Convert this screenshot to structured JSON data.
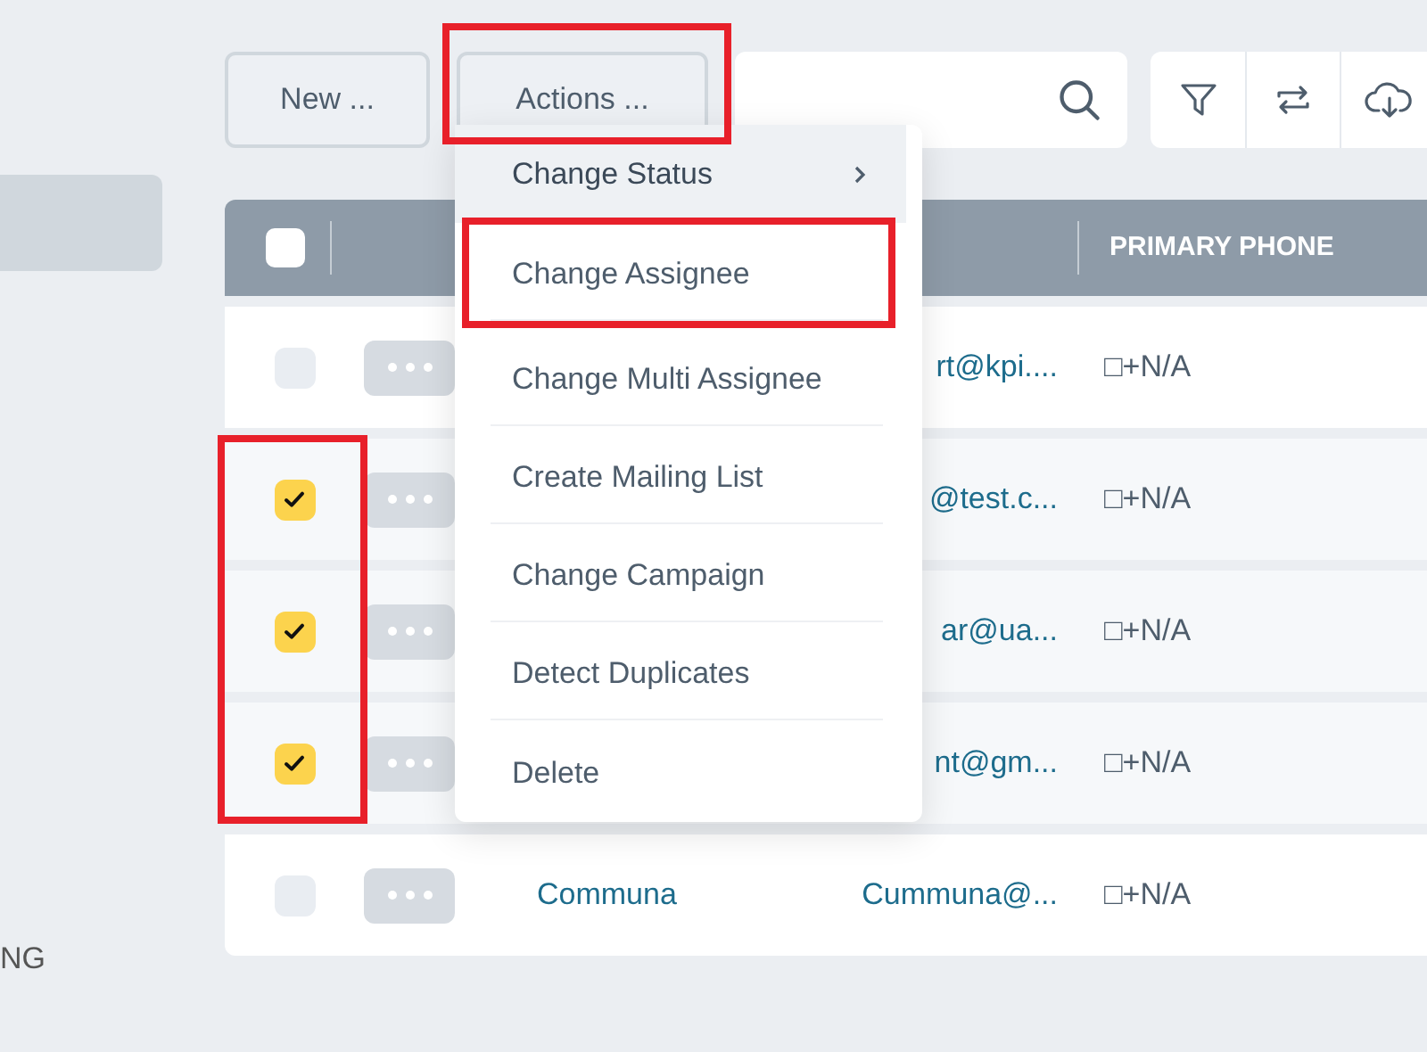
{
  "sidebar": {
    "items": [
      {
        "selected": true
      },
      {
        "label": "NG",
        "selected": false
      }
    ]
  },
  "toolbar": {
    "buttons": [
      "New ...",
      "Actions ..."
    ]
  },
  "table": {
    "header_checked": false,
    "columns": [
      "PRIMARY PHONE"
    ],
    "rows": [
      {
        "checked": false,
        "email": "rt@kpi....",
        "phone": "□+N/A"
      },
      {
        "checked": true,
        "email": "@test.c...",
        "phone": "□+N/A"
      },
      {
        "checked": true,
        "email": "ar@ua...",
        "phone": "□+N/A"
      },
      {
        "checked": true,
        "email": "nt@gm...",
        "phone": "□+N/A"
      },
      {
        "checked": false,
        "name": "Communa",
        "email": "Cummuna@...",
        "phone": "□+N/A"
      }
    ]
  },
  "menu": {
    "items": [
      {
        "label": "Change Status",
        "submenu": true,
        "highlighted": true
      },
      {
        "label": "Change Assignee",
        "submenu": false,
        "highlighted": false
      },
      {
        "label": "Change Multi Assignee",
        "submenu": false,
        "highlighted": false
      },
      {
        "label": "Create Mailing List",
        "submenu": false,
        "highlighted": false
      },
      {
        "label": "Change Campaign",
        "submenu": false,
        "highlighted": false
      },
      {
        "label": "Detect Duplicates",
        "submenu": false,
        "highlighted": false
      },
      {
        "label": "Delete",
        "submenu": false,
        "highlighted": false
      }
    ]
  }
}
